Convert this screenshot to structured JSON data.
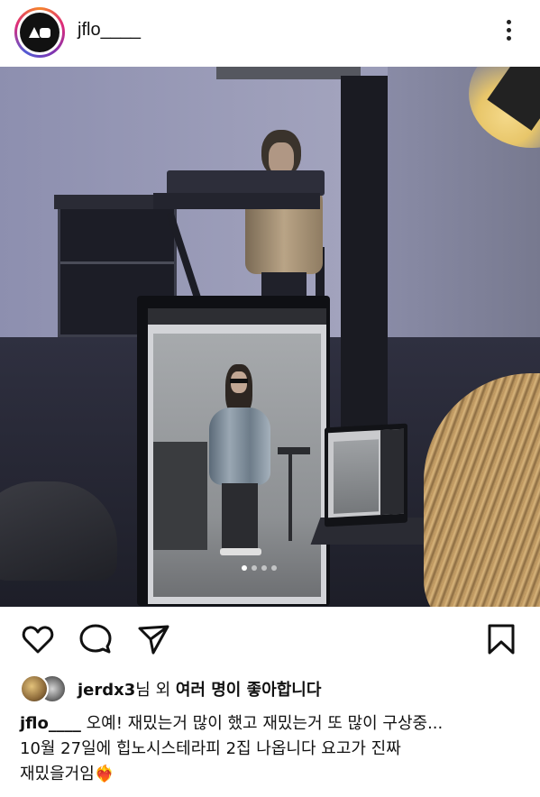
{
  "header": {
    "username": "jflo____",
    "avatar_icon": "logo-avatar-icon",
    "more_icon": "more-vertical-icon"
  },
  "post": {
    "carousel": {
      "count": 4,
      "active_index": 0
    }
  },
  "actions": {
    "like_icon": "heart-icon",
    "comment_icon": "comment-icon",
    "share_icon": "send-icon",
    "save_icon": "bookmark-icon"
  },
  "likes": {
    "user": "jerdx3",
    "suffix": "님 외 ",
    "others": "여러 명이 좋아합니다"
  },
  "caption": {
    "username": "jflo____",
    "line1": " 오예! 재밌는거 많이 했고 재밌는거 또 많이 구상중...",
    "line2": "10월 27일에 힙노시스테라피 2집 나옵니다 요고가 진짜",
    "line3": "재밌을거임",
    "emoji": "❤️‍🔥"
  },
  "colors": {
    "text": "#111111",
    "background": "#ffffff",
    "story_ring": [
      "#f58529",
      "#dd2a7b",
      "#8134af",
      "#515bd4"
    ]
  }
}
